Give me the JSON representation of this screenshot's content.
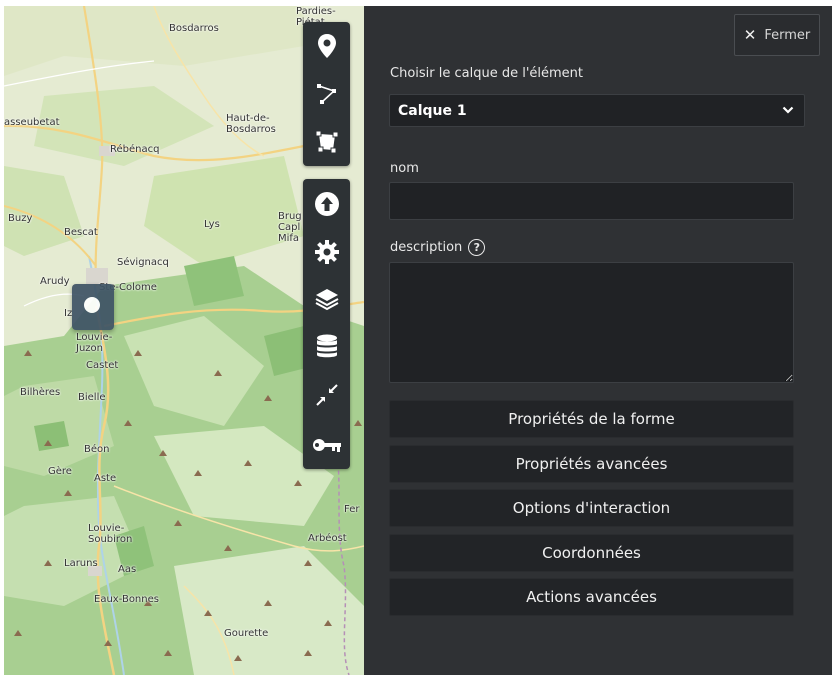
{
  "map": {
    "places": [
      {
        "id": "pardies",
        "label": "Pardies-\nPiétat"
      },
      {
        "id": "bosdarros",
        "label": "Bosdarros"
      },
      {
        "id": "asseubetat",
        "label": "asseubetat"
      },
      {
        "id": "haut-de-bosdarros",
        "label": "Haut-de-\nBosdarros"
      },
      {
        "id": "rebenacq",
        "label": "Rébénacq"
      },
      {
        "id": "buzy",
        "label": "Buzy"
      },
      {
        "id": "bescat",
        "label": "Bescat"
      },
      {
        "id": "lys",
        "label": "Lys"
      },
      {
        "id": "brugcaplmifa",
        "label": "Brug\nCapl\nMifa"
      },
      {
        "id": "sevignacq",
        "label": "Sévignacq"
      },
      {
        "id": "arudy",
        "label": "Arudy"
      },
      {
        "id": "ste-colome",
        "label": "Ste-Colome"
      },
      {
        "id": "iz",
        "label": "Iz"
      },
      {
        "id": "louvie-juzon",
        "label": "Louvie-\nJuzon"
      },
      {
        "id": "castet",
        "label": "Castet"
      },
      {
        "id": "bilheres",
        "label": "Bilhères"
      },
      {
        "id": "bielle",
        "label": "Bielle"
      },
      {
        "id": "beon",
        "label": "Béon"
      },
      {
        "id": "gere",
        "label": "Gère"
      },
      {
        "id": "aste",
        "label": "Aste"
      },
      {
        "id": "fer",
        "label": "Fer"
      },
      {
        "id": "louvie-soubiron",
        "label": "Louvie-\nSoubiron"
      },
      {
        "id": "arbeost",
        "label": "Arbéost"
      },
      {
        "id": "laruns",
        "label": "Laruns"
      },
      {
        "id": "aas",
        "label": "Aas"
      },
      {
        "id": "eaux-bonnes",
        "label": "Eaux-Bonnes"
      },
      {
        "id": "gourette",
        "label": "Gourette"
      }
    ]
  },
  "toolbar": {
    "draw": [
      "marker-icon",
      "polyline-icon",
      "polygon-icon"
    ],
    "main": [
      "upload-icon",
      "gear-icon",
      "layers-icon",
      "database-icon",
      "compress-icon",
      "key-icon"
    ]
  },
  "panel": {
    "close_label": "Fermer",
    "layer_label": "Choisir le calque de l'élément",
    "layer_value": "Calque 1",
    "name_label": "nom",
    "name_value": "",
    "description_label": "description",
    "description_value": "",
    "help_glyph": "?",
    "sections": [
      "Propriétés de la forme",
      "Propriétés avancées",
      "Options d'interaction",
      "Coordonnées",
      "Actions avancées"
    ]
  },
  "colors": {
    "panel_bg": "#2f3134",
    "input_bg": "#202225",
    "toolbar_bg": "#2d3235",
    "marker": "#3e5365",
    "forest": "#9fca8a"
  }
}
